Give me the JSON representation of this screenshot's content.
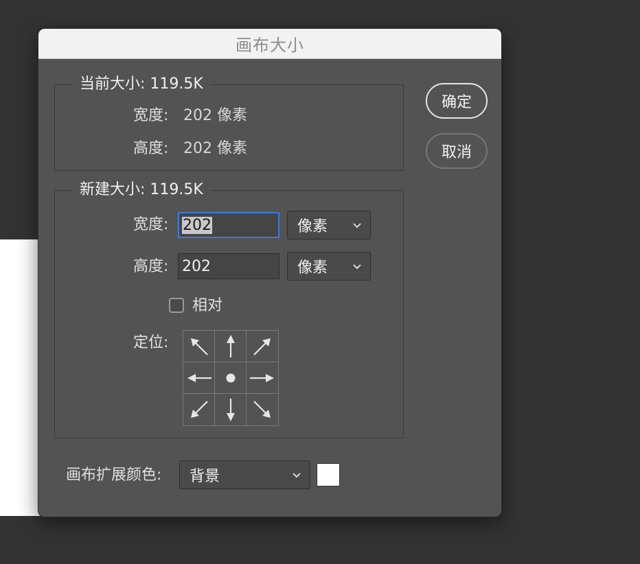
{
  "dialog": {
    "title": "画布大小",
    "ok_label": "确定",
    "cancel_label": "取消"
  },
  "current_size": {
    "title": "当前大小: 119.5K",
    "width_label": "宽度:",
    "width_value": "202 像素",
    "height_label": "高度:",
    "height_value": "202 像素"
  },
  "new_size": {
    "title": "新建大小: 119.5K",
    "width_label": "宽度:",
    "width_value": "202",
    "width_unit": "像素",
    "height_label": "高度:",
    "height_value": "202",
    "height_unit": "像素",
    "relative_label": "相对",
    "relative_checked": false,
    "anchor_label": "定位:",
    "anchor_selected": "center"
  },
  "extension_color": {
    "label": "画布扩展颜色:",
    "value": "背景",
    "swatch_color": "#ffffff"
  },
  "colors": {
    "dialog_bg": "#535353",
    "focus_ring": "#3d7bd9"
  }
}
